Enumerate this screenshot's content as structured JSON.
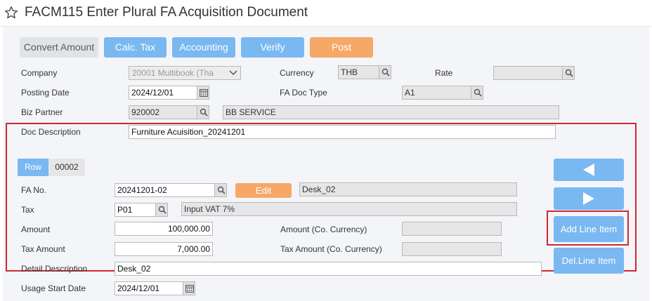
{
  "title": "FACM115 Enter Plural FA Acquisition Document",
  "toolbar": {
    "convert_amount": "Convert Amount",
    "calc_tax": "Calc. Tax",
    "accounting": "Accounting",
    "verify": "Verify",
    "post": "Post"
  },
  "header": {
    "company_label": "Company",
    "company_value": "20001 Multibook (Tha",
    "currency_label": "Currency",
    "currency_value": "THB",
    "rate_label": "Rate",
    "rate_value": "",
    "posting_date_label": "Posting Date",
    "posting_date_value": "2024/12/01",
    "fa_doc_type_label": "FA Doc Type",
    "fa_doc_type_value": "A1",
    "biz_partner_label": "Biz Partner",
    "biz_partner_code": "920002",
    "biz_partner_name": "BB SERVICE",
    "doc_description_label": "Doc Description",
    "doc_description_value": "Furniture Acuisition_20241201"
  },
  "line": {
    "row_label": "Row",
    "row_value": "00002",
    "fa_no_label": "FA No.",
    "fa_no_value": "20241201-02",
    "edit_label": "Edit",
    "fa_name_value": "Desk_02",
    "tax_label": "Tax",
    "tax_code": "P01",
    "tax_name": "Input VAT 7%",
    "amount_label": "Amount",
    "amount_value": "100,000.00",
    "amount_co_label": "Amount (Co. Currency)",
    "amount_co_value": "",
    "tax_amount_label": "Tax Amount",
    "tax_amount_value": "7,000.00",
    "tax_amount_co_label": "Tax Amount (Co. Currency)",
    "tax_amount_co_value": "",
    "detail_description_label": "Detail Description",
    "detail_description_value": "Desk_02",
    "usage_start_date_label": "Usage Start Date",
    "usage_start_date_value": "2024/12/01"
  },
  "side": {
    "add_line_item": "Add Line Item",
    "del_line_item": "Del.Line Item"
  },
  "colors": {
    "accent_blue": "#7ab8f1",
    "accent_orange": "#f6a867",
    "highlight_red": "#d0282e"
  }
}
